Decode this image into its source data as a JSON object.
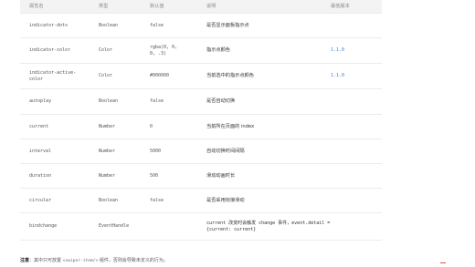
{
  "table": {
    "headers": [
      "属性名",
      "类型",
      "默认值",
      "说明",
      "最低版本"
    ],
    "rows": [
      {
        "name": "indicator-dots",
        "type": "Boolean",
        "default": "false",
        "desc": "是否显示面板指示点",
        "version": ""
      },
      {
        "name": "indicator-color",
        "type": "Color",
        "default": "rgba(0, 0, 0, .3)",
        "desc": "指示点颜色",
        "version": "1.1.0"
      },
      {
        "name": "indicator-active-color",
        "type": "Color",
        "default": "#000000",
        "desc": "当前选中的指示点颜色",
        "version": "1.1.0"
      },
      {
        "name": "autoplay",
        "type": "Boolean",
        "default": "false",
        "desc": "是否自动切换",
        "version": ""
      },
      {
        "name": "current",
        "type": "Number",
        "default": "0",
        "desc": "当前所在页面的 index",
        "version": ""
      },
      {
        "name": "interval",
        "type": "Number",
        "default": "5000",
        "desc": "自动切换时间间隔",
        "version": ""
      },
      {
        "name": "duration",
        "type": "Number",
        "default": "500",
        "desc": "滑动动画时长",
        "version": ""
      },
      {
        "name": "circular",
        "type": "Boolean",
        "default": "false",
        "desc": "是否采用衔接滑动",
        "version": ""
      },
      {
        "name": "bindchange",
        "type": "EventHandle",
        "default": "",
        "desc": "current 改变时会触发 change 事件，event.detail = {current: current}",
        "version": ""
      }
    ]
  },
  "note": {
    "label": "注意",
    "text_before": "：其中只可放置 ",
    "code": "<swiper-item/>",
    "text_after": " 组件，否则会导致未定义的行为。"
  }
}
